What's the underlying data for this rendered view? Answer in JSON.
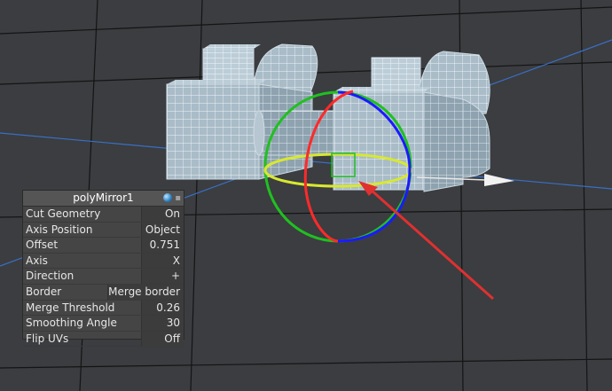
{
  "panel": {
    "title": "polyMirror1",
    "icon": "shading-sphere-icon",
    "rows": [
      {
        "label": "Cut Geometry",
        "value": "On"
      },
      {
        "label": "Axis Position",
        "value": "Object"
      },
      {
        "label": "Offset",
        "value": "0.751"
      },
      {
        "label": "Axis",
        "value": "X"
      },
      {
        "label": "Direction",
        "value": "+"
      },
      {
        "label": "Border",
        "value": "Merge border"
      },
      {
        "label": "Merge Threshold",
        "value": "0.26"
      },
      {
        "label": "Smoothing Angle",
        "value": "30"
      },
      {
        "label": "Flip UVs",
        "value": "Off"
      }
    ]
  },
  "colors": {
    "background": "#3b3d40",
    "mesh_fill": "#9fb4c2",
    "rotate_x": "#ff2a2a",
    "rotate_y": "#20c020",
    "rotate_z": "#1a1aff",
    "annotation_arrow": "#e03030",
    "axis_line": "#3a6fc4"
  }
}
